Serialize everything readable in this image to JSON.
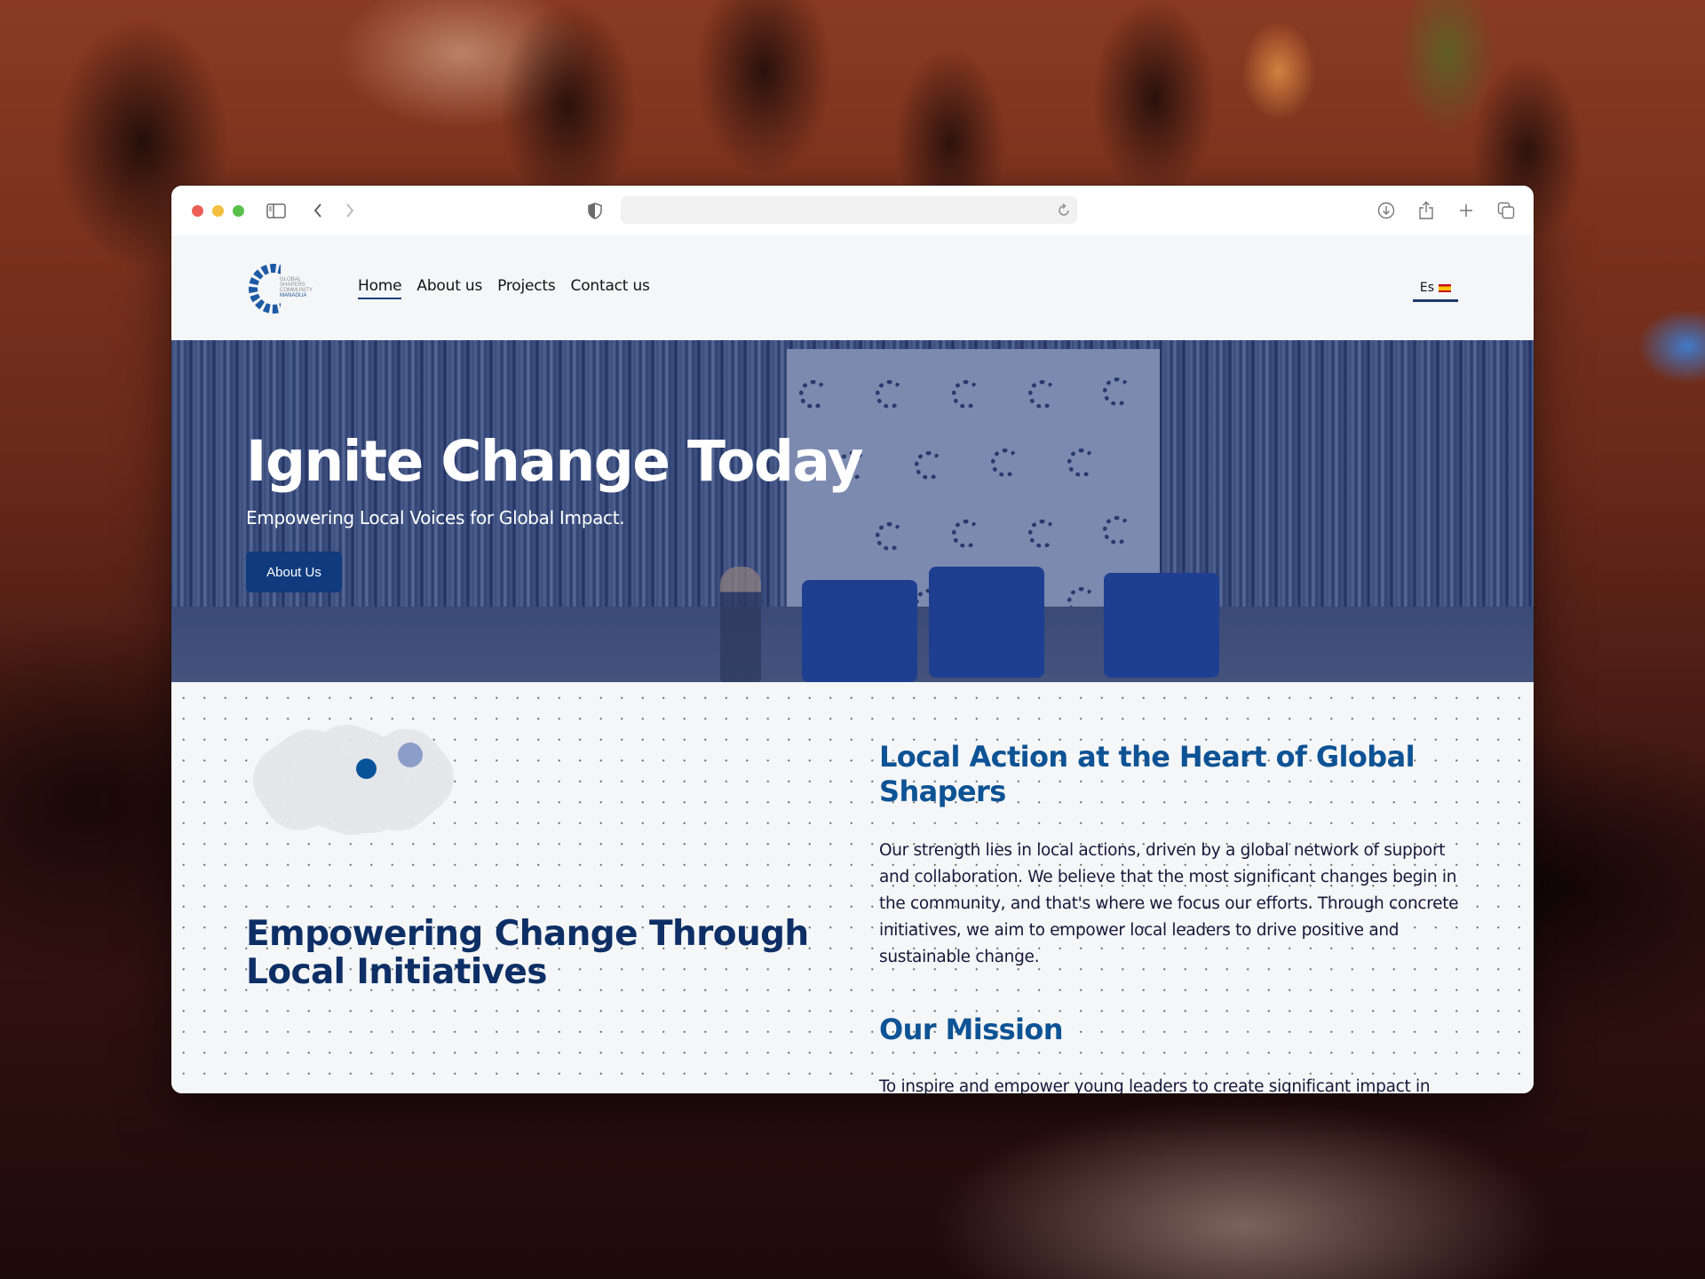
{
  "browser": {
    "traffic_lights": [
      "close",
      "minimize",
      "zoom"
    ],
    "toolbar_icons": {
      "sidebar": "sidebar-icon",
      "back": "chevron-left-icon",
      "forward": "chevron-right-icon",
      "privacy": "shield-icon",
      "reload": "reload-icon",
      "download": "download-icon",
      "share": "share-icon",
      "new_tab": "plus-icon",
      "tabs": "tab-overview-icon"
    },
    "url": ""
  },
  "site": {
    "logo": {
      "lines": [
        "GLOBAL",
        "SHAPERS",
        "COMMUNITY",
        "MANAGUA"
      ]
    },
    "nav": [
      {
        "label": "Home",
        "active": true
      },
      {
        "label": "About us",
        "active": false
      },
      {
        "label": "Projects",
        "active": false
      },
      {
        "label": "Contact us",
        "active": false
      }
    ],
    "language": {
      "label": "Es",
      "flag": "spain-flag-icon"
    },
    "colors": {
      "primary_dark": "#0d2f66",
      "primary": "#0d5395",
      "button": "#0f3a7e",
      "accent_light": "#8c9dc9"
    }
  },
  "hero": {
    "title": "Ignite Change Today",
    "subtitle": "Empowering Local Voices for Global Impact.",
    "button_label": "About Us"
  },
  "content": {
    "left_heading": "Empowering Change Through Local Initiatives",
    "sections": [
      {
        "heading": "Local Action at the Heart of Global Shapers",
        "body": "Our strength lies in local actions, driven by a global network of support and collaboration. We believe that the most significant changes begin in the community, and that's where we focus our efforts. Through concrete initiatives, we aim to empower local leaders to drive positive and sustainable change."
      },
      {
        "heading": "Our Mission",
        "body": "To inspire and empower young leaders to create significant impact in"
      }
    ]
  }
}
